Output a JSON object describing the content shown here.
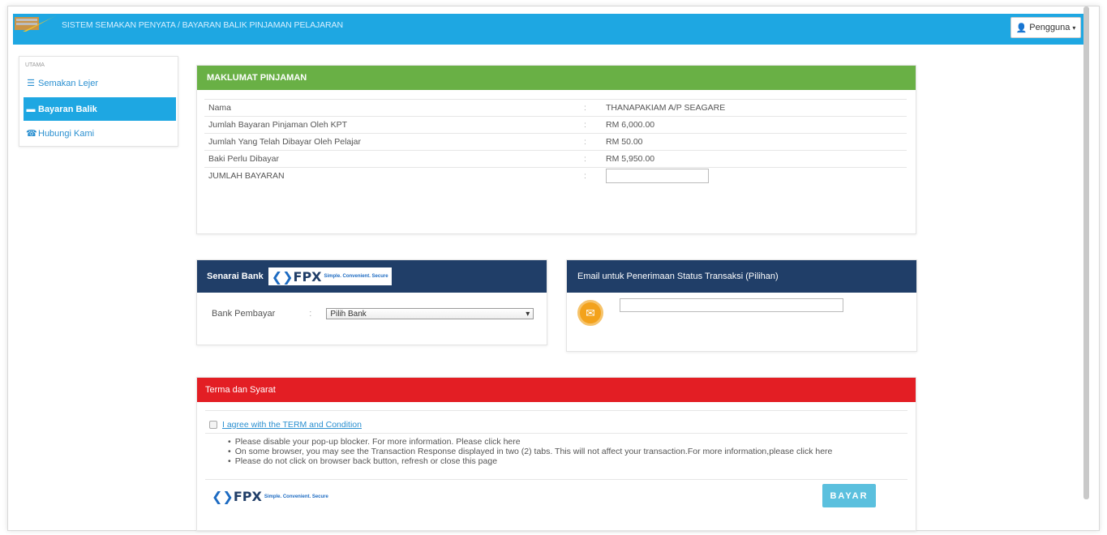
{
  "app": {
    "title": "SISTEM SEMAKAN PENYATA / BAYARAN BALIK PINJAMAN PELAJARAN",
    "user_menu": "Pengguna",
    "brand_color": "#1ea7e2"
  },
  "sidebar": {
    "section": "UTAMA",
    "items": [
      {
        "label": "Semakan Lejer",
        "icon": "list-icon"
      },
      {
        "label": "Bayaran Balik",
        "icon": "card-icon"
      },
      {
        "label": "Hubungi Kami",
        "icon": "phone-icon"
      }
    ]
  },
  "loan": {
    "title": "MAKLUMAT PINJAMAN",
    "rows": [
      {
        "label": "Nama",
        "value": "THANAPAKIAM A/P SEAGARE"
      },
      {
        "label": "Jumlah Bayaran Pinjaman Oleh KPT",
        "value": "RM 6,000.00"
      },
      {
        "label": "Jumlah Yang Telah Dibayar Oleh Pelajar",
        "value": "RM 50.00"
      },
      {
        "label": "Baki Perlu Dibayar",
        "value": "RM 5,950.00"
      },
      {
        "label": "JUMLAH BAYARAN",
        "value": ""
      }
    ],
    "colon": ":"
  },
  "bank": {
    "title": "Senarai Bank",
    "fpx_logo": "FPX",
    "fpx_tagline": "Simple. Convenient. Secure",
    "label": "Bank Pembayar",
    "select_value": "Pilih Bank"
  },
  "email": {
    "title": "Email untuk Penerimaan Status Transaksi (Pilihan)",
    "value": ""
  },
  "terms": {
    "title": "Terma dan Syarat",
    "agree_label": "I agree with the TERM and Condition",
    "notes": [
      "Please disable your pop-up blocker. For more information. Please click here",
      "On some browser, you may see the Transaction Response displayed in two (2) tabs. This will not affect your transaction.For more information,please click here",
      "Please do not click on browser back button, refresh or close this page"
    ],
    "pay_button": "BAYAR"
  },
  "colors": {
    "loan_header": "#69b045",
    "bank_header": "#203e68",
    "terms_header": "#e31e24",
    "pay_button": "#5bc0de"
  }
}
